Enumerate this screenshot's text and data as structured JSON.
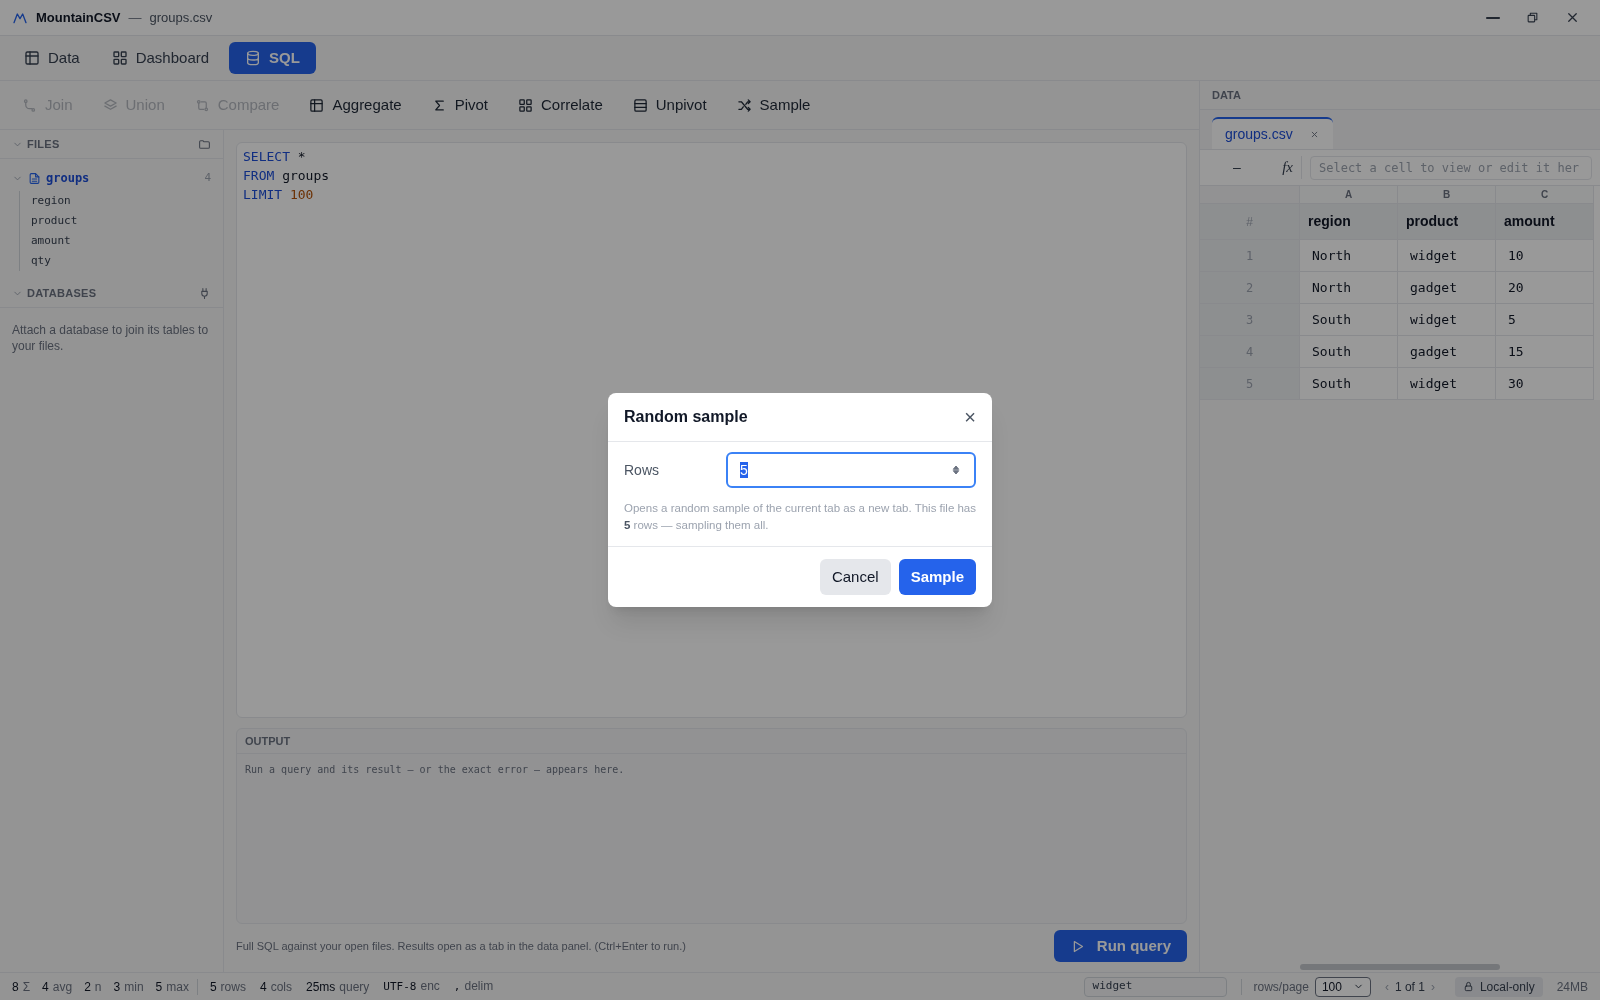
{
  "window": {
    "app": "MountainCSV",
    "separator": "—",
    "file": "groups.csv"
  },
  "main_tabs": [
    {
      "label": "Data",
      "selected": false
    },
    {
      "label": "Dashboard",
      "selected": false
    },
    {
      "label": "SQL",
      "selected": true
    }
  ],
  "toolbar": [
    {
      "label": "Join",
      "disabled": true
    },
    {
      "label": "Union",
      "disabled": true
    },
    {
      "label": "Compare",
      "disabled": true
    },
    {
      "label": "Aggregate",
      "disabled": false
    },
    {
      "label": "Pivot",
      "disabled": false
    },
    {
      "label": "Correlate",
      "disabled": false
    },
    {
      "label": "Unpivot",
      "disabled": false
    },
    {
      "label": "Sample",
      "disabled": false
    }
  ],
  "sidebar": {
    "files_header": "FILES",
    "files": [
      {
        "name": "groups",
        "count": "4",
        "expanded": true,
        "children": [
          {
            "name": "region"
          },
          {
            "name": "product"
          },
          {
            "name": "amount"
          },
          {
            "name": "qty"
          }
        ]
      }
    ],
    "databases_header": "DATABASES",
    "databases_hint": "Attach a database to join its tables to your files."
  },
  "editor": {
    "lines": [
      [
        {
          "kind": "keyword",
          "text": "SELECT"
        },
        {
          "kind": "plain",
          "text": "*"
        }
      ],
      [
        {
          "kind": "keyword",
          "text": "FROM"
        },
        {
          "kind": "plain",
          "text": "groups"
        }
      ],
      [
        {
          "kind": "keyword",
          "text": "LIMIT"
        },
        {
          "kind": "number",
          "text": "100"
        }
      ]
    ]
  },
  "output": {
    "header": "OUTPUT",
    "message": "Run a query and its result — or the exact error — appears here."
  },
  "footer_hint": "Full SQL against your open files. Results open as a tab in the data panel. (Ctrl+Enter to run.)",
  "run_button": "Run query",
  "data_panel": {
    "header": "DATA",
    "tabs": [
      {
        "label": "groups.csv",
        "selected": true
      }
    ],
    "formula_bar": {
      "cell_ref": "–",
      "fx": "fx",
      "placeholder": "Select a cell to view or edit it her"
    },
    "column_letters": [
      "A",
      "B",
      "C"
    ],
    "row_number_header": "#",
    "columns": [
      "region",
      "product",
      "amount"
    ],
    "rows": [
      {
        "number": "1",
        "cells": [
          "North",
          "widget",
          "10"
        ]
      },
      {
        "number": "2",
        "cells": [
          "North",
          "gadget",
          "20"
        ]
      },
      {
        "number": "3",
        "cells": [
          "South",
          "widget",
          "5"
        ]
      },
      {
        "number": "4",
        "cells": [
          "South",
          "gadget",
          "15"
        ]
      },
      {
        "number": "5",
        "cells": [
          "South",
          "widget",
          "30"
        ]
      }
    ]
  },
  "status_bar": {
    "stats": [
      {
        "value": "8",
        "suffix": "Σ"
      },
      {
        "value": "4",
        "suffix": "avg"
      },
      {
        "value": "2",
        "suffix": "n"
      },
      {
        "value": "3",
        "suffix": "min"
      },
      {
        "value": "5",
        "suffix": "max"
      }
    ],
    "info": [
      {
        "value": "5",
        "suffix": "rows",
        "kind": "sans"
      },
      {
        "value": "4",
        "suffix": "cols",
        "kind": "sans"
      },
      {
        "value": "25ms",
        "suffix": "query",
        "kind": "sans"
      },
      {
        "value": "UTF-8",
        "suffix": "enc",
        "kind": "mono"
      },
      {
        "value": ",",
        "suffix": "delim",
        "kind": "mono"
      }
    ],
    "cell_value": "widget",
    "rows_per_page_label": "rows/page",
    "rows_per_page": "100",
    "prev": "‹",
    "page": "1 of 1",
    "next": "›",
    "local": "Local-only",
    "memory": "24MB"
  },
  "dialog": {
    "title": "Random sample",
    "close": "×",
    "field_label": "Rows",
    "field_value": "5",
    "description": "Opens a random sample of the current tab as a new tab. This file has **5** rows — sampling them all.",
    "buttons": [
      {
        "label": "Cancel",
        "kind": "secondary"
      },
      {
        "label": "Sample",
        "kind": "primary"
      }
    ]
  }
}
